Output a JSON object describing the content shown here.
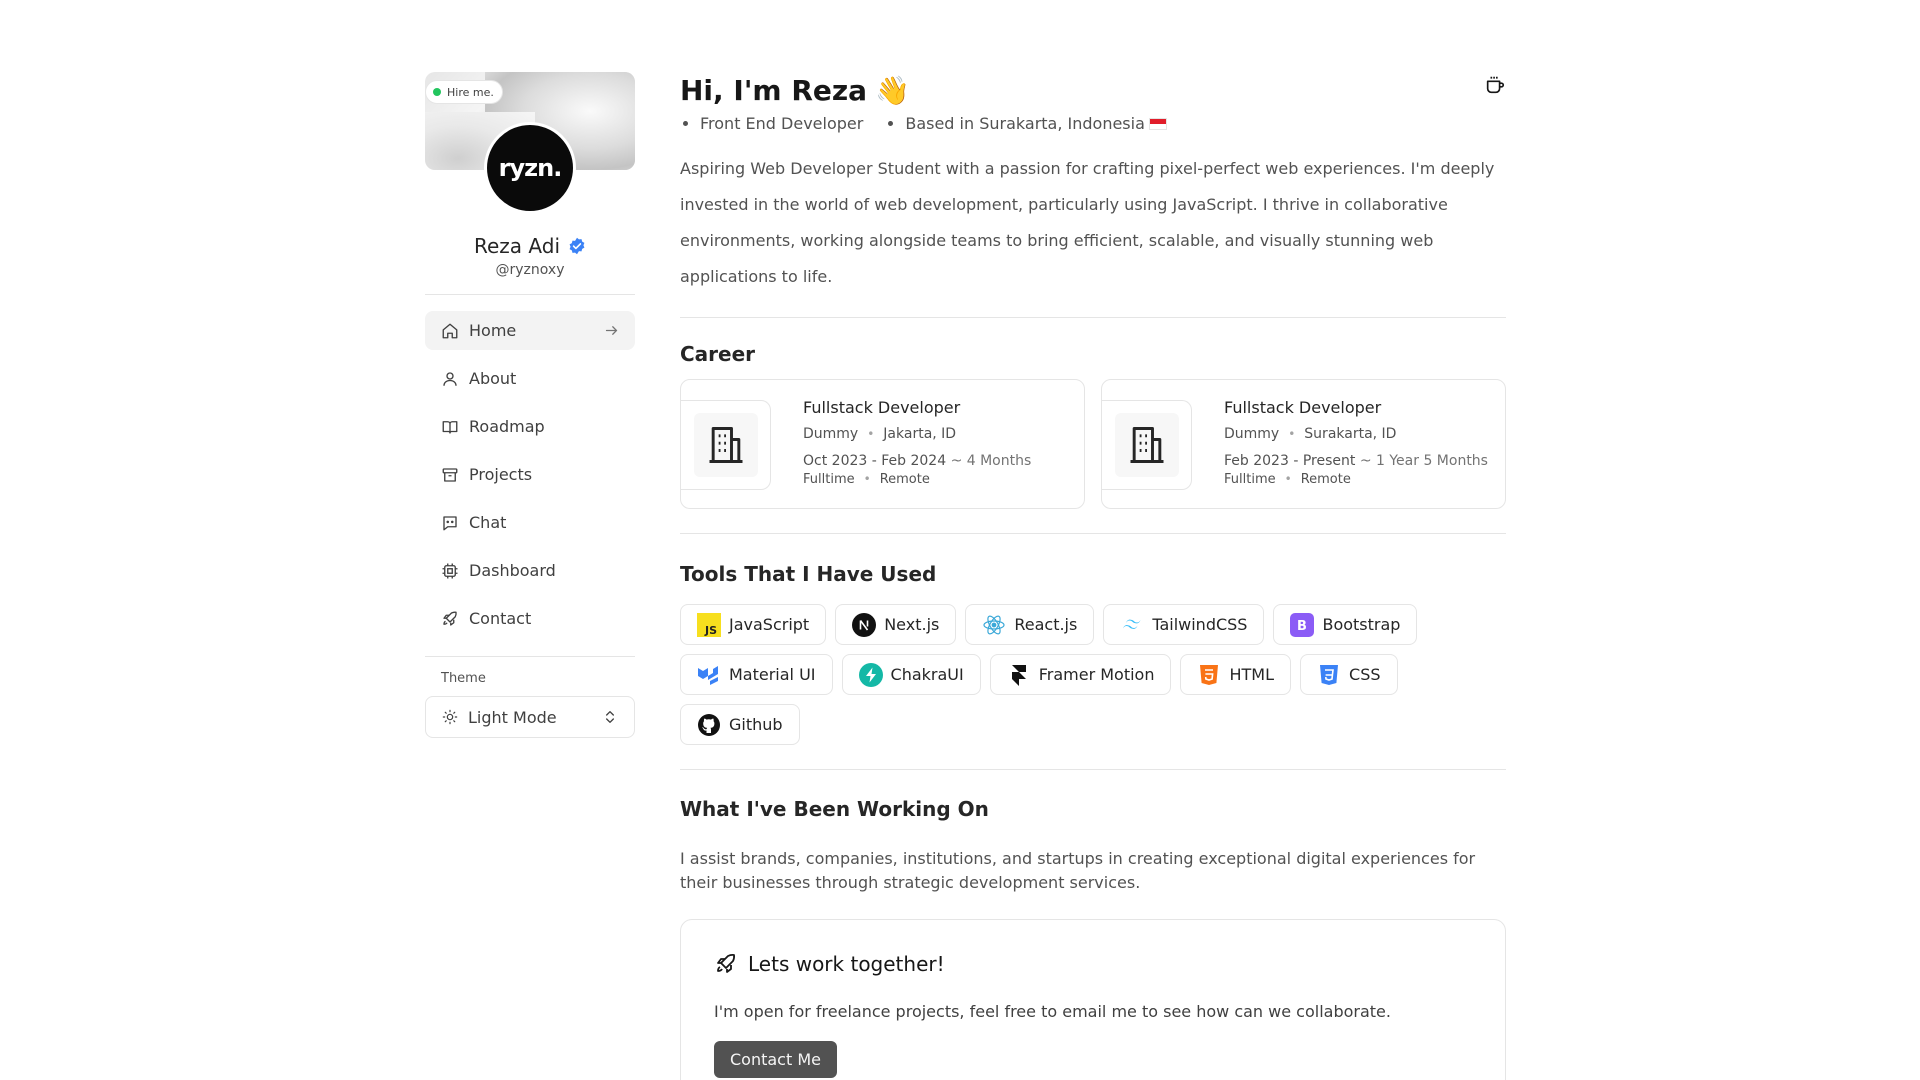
{
  "profile": {
    "hire_label": "Hire me.",
    "logo_text": "ryzn.",
    "name": "Reza Adi",
    "handle": "@ryznoxy"
  },
  "nav": {
    "items": [
      {
        "label": "Home",
        "icon": "home-icon"
      },
      {
        "label": "About",
        "icon": "user-icon"
      },
      {
        "label": "Roadmap",
        "icon": "book-icon"
      },
      {
        "label": "Projects",
        "icon": "archive-icon"
      },
      {
        "label": "Chat",
        "icon": "chat-icon"
      },
      {
        "label": "Dashboard",
        "icon": "cpu-icon"
      },
      {
        "label": "Contact",
        "icon": "rocket-icon"
      }
    ]
  },
  "theme": {
    "label": "Theme",
    "value": "Light Mode"
  },
  "hero": {
    "title": "Hi, I'm Reza",
    "emoji": "👋",
    "role": "Front End Developer",
    "location": "Based in Surakarta, Indonesia",
    "bio": "Aspiring Web Developer Student with a passion for crafting pixel-perfect web experiences. I'm deeply invested in the world of web development, particularly using JavaScript. I thrive in collaborative environments, working alongside teams to bring efficient, scalable, and visually stunning web applications to life."
  },
  "career": {
    "title": "Career",
    "items": [
      {
        "role": "Fullstack Developer",
        "company": "Dummy",
        "location": "Jakarta, ID",
        "dates": "Oct 2023 - Feb 2024",
        "duration": "~ 4 Months",
        "type": "Fulltime",
        "mode": "Remote"
      },
      {
        "role": "Fullstack Developer",
        "company": "Dummy",
        "location": "Surakarta, ID",
        "dates": "Feb 2023 - Present",
        "duration": "~ 1 Year 5 Months",
        "type": "Fulltime",
        "mode": "Remote"
      }
    ]
  },
  "tools": {
    "title": "Tools That I Have Used",
    "items": [
      "JavaScript",
      "Next.js",
      "React.js",
      "TailwindCSS",
      "Bootstrap",
      "Material UI",
      "ChakraUI",
      "Framer Motion",
      "HTML",
      "CSS",
      "Github"
    ]
  },
  "work": {
    "title": "What I've Been Working On",
    "description": "I assist brands, companies, institutions, and startups in creating exceptional digital experiences for their businesses through strategic development services.",
    "card_title": "Lets work together!",
    "card_text": "I'm open for freelance projects, feel free to email me to see how can we collaborate.",
    "button": "Contact Me"
  },
  "colors": {
    "status_green": "#22c55e",
    "verified_blue": "#3b82f6",
    "button_bg": "#525252"
  }
}
